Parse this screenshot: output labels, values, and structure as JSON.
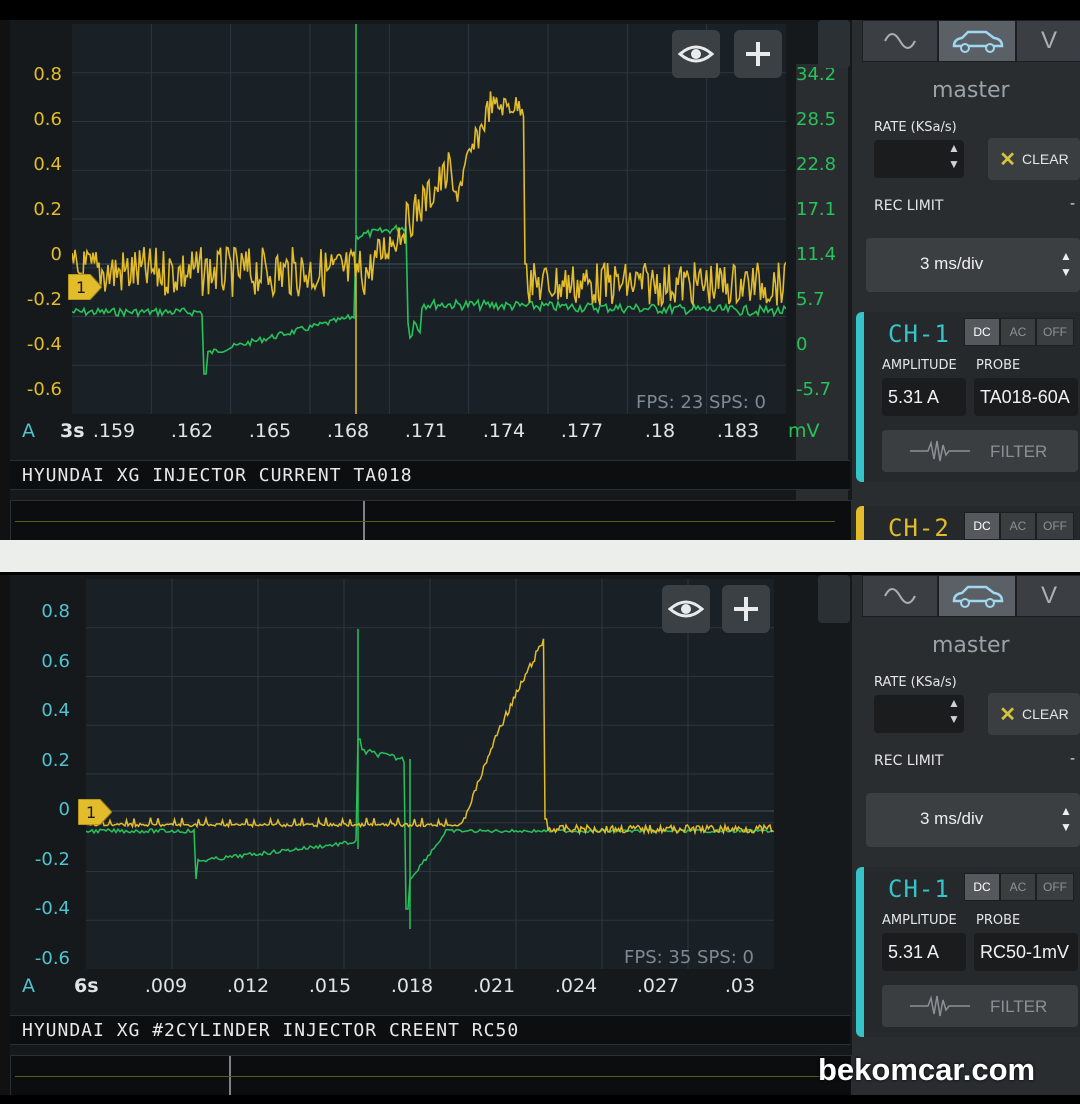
{
  "watermark": "bekomcar.com",
  "colors": {
    "ch1": "#e2bc2a",
    "ch2": "#27c25a",
    "cyan_axis": "#4fc4d0",
    "accent": "#35c5c9"
  },
  "panels": [
    {
      "id": "top",
      "title": "HYUNDAI XG INJECTOR CURRENT TA018",
      "left_axis_unit": "A",
      "right_axis_unit": "mV",
      "time_scale": "3s",
      "y_left_ticks": [
        "0.8",
        "0.6",
        "0.4",
        "0.2",
        "0",
        "-0.2",
        "-0.4",
        "-0.6"
      ],
      "y_right_ticks": [
        "34.2",
        "28.5",
        "22.8",
        "17.1",
        "11.4",
        "5.7",
        "0",
        "-5.7"
      ],
      "x_ticks": [
        ".159",
        ".162",
        ".165",
        ".168",
        ".171",
        ".174",
        ".177",
        ".18",
        ".183"
      ],
      "fps_label": "FPS: 23  SPS: 0",
      "marker_label": "1",
      "right_panel": {
        "tabs": [
          "wave-icon",
          "car-icon",
          "voltmeter-icon"
        ],
        "tab_v_label": "V",
        "master_label": "master",
        "rate_label": "RATE (KSa/s)",
        "rate_value": "",
        "clear_label": "CLEAR",
        "rec_limit_label": "REC LIMIT",
        "rec_limit_value": "-",
        "timebase": "3 ms/div",
        "ch1": {
          "label": "CH-1",
          "coupling": [
            "DC",
            "AC",
            "OFF"
          ],
          "active": "DC",
          "amplitude_label": "AMPLITUDE",
          "probe_label": "PROBE",
          "amplitude": "5.31 A",
          "probe": "TA018-60A",
          "filter_label": "FILTER"
        },
        "ch2": {
          "label": "CH-2",
          "coupling": [
            "DC",
            "AC",
            "OFF"
          ],
          "active": "DC"
        }
      }
    },
    {
      "id": "bottom",
      "title": "HYUNDAI XG #2CYLINDER INJECTOR CREENT RC50",
      "left_axis_unit": "A",
      "right_axis_unit": "",
      "time_scale": "6s",
      "y_left_ticks": [
        "0.8",
        "0.6",
        "0.4",
        "0.2",
        "0",
        "-0.2",
        "-0.4",
        "-0.6"
      ],
      "y_right_ticks": [],
      "x_ticks": [
        ".009",
        ".012",
        ".015",
        ".018",
        ".021",
        ".024",
        ".027",
        ".03"
      ],
      "fps_label": "FPS: 35  SPS: 0",
      "marker_label": "1",
      "right_panel": {
        "tabs": [
          "wave-icon",
          "car-icon",
          "voltmeter-icon"
        ],
        "tab_v_label": "V",
        "master_label": "master",
        "rate_label": "RATE (KSa/s)",
        "rate_value": "",
        "clear_label": "CLEAR",
        "rec_limit_label": "REC LIMIT",
        "rec_limit_value": "-",
        "timebase": "3 ms/div",
        "ch1": {
          "label": "CH-1",
          "coupling": [
            "DC",
            "AC",
            "OFF"
          ],
          "active": "DC",
          "amplitude_label": "AMPLITUDE",
          "probe_label": "PROBE",
          "amplitude": "5.31 A",
          "probe": "RC50-1mV",
          "filter_label": "FILTER"
        }
      }
    }
  ]
}
